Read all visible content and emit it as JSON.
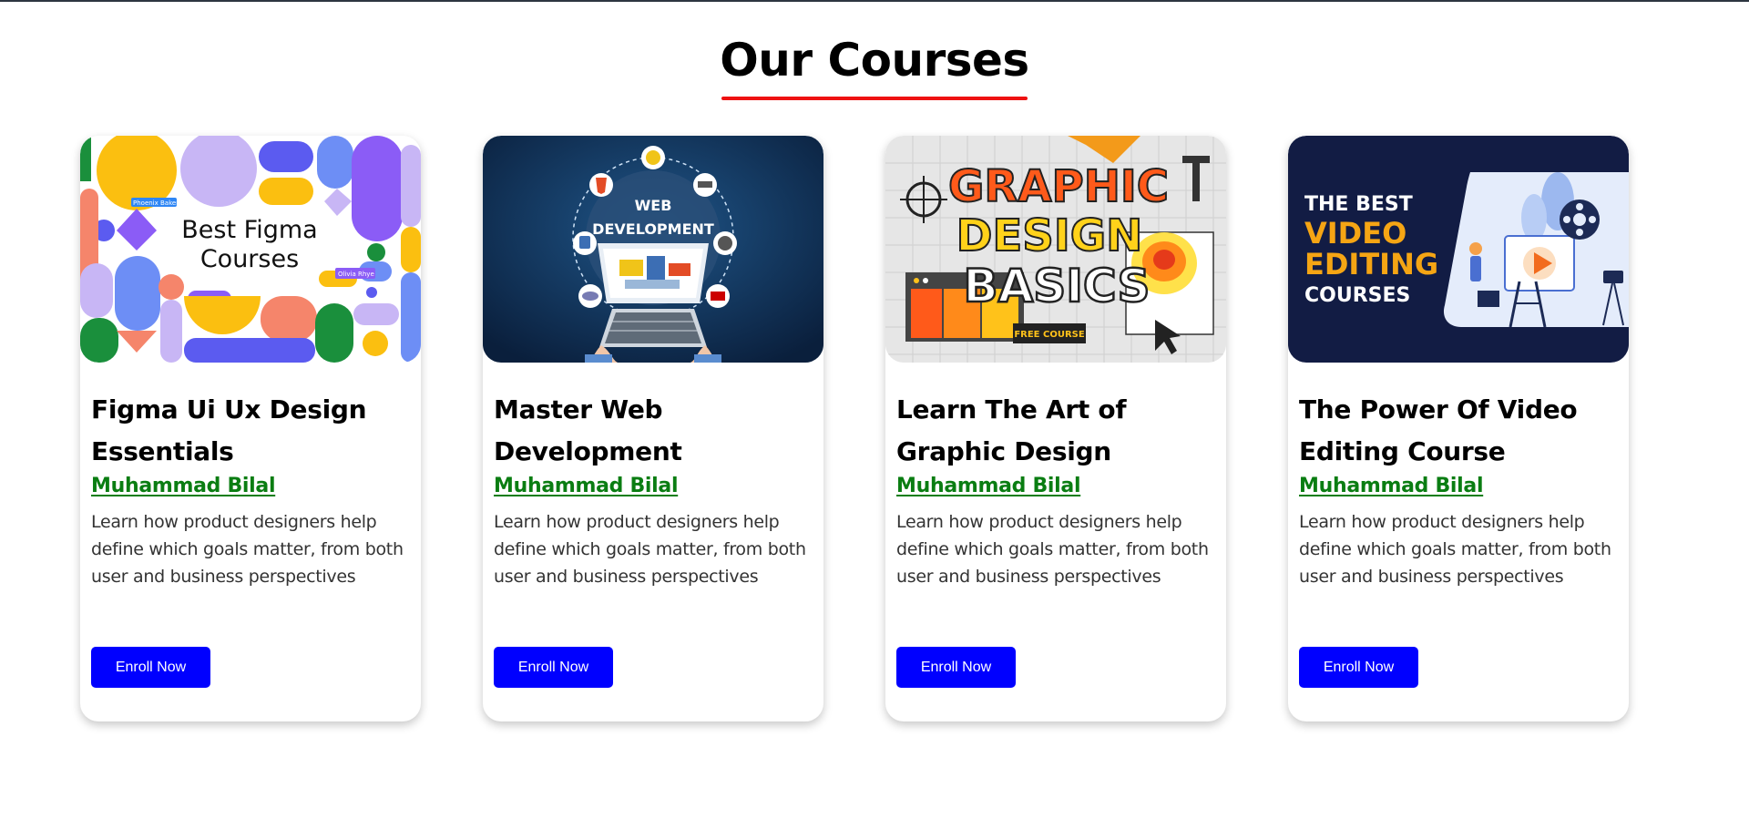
{
  "page": {
    "heading": "Our Courses"
  },
  "courses": [
    {
      "thumb_text": [
        "Best Figma",
        "Courses"
      ],
      "thumb_tags": [
        "Phoenix Baker",
        "Olivia Rhye"
      ],
      "title": "Figma Ui Ux Design Essentials",
      "author": "Muhammad Bilal",
      "description": "Learn how product designers help define which goals matter, from both user and business perspectives",
      "button": "Enroll Now"
    },
    {
      "thumb_text": [
        "WEB",
        "DEVELOPMENT"
      ],
      "title": "Master Web Development",
      "author": "Muhammad Bilal",
      "description": "Learn how product designers help define which goals matter, from both user and business perspectives",
      "button": "Enroll Now"
    },
    {
      "thumb_text": [
        "GRAPHIC",
        "DESIGN",
        "BASICS",
        "FREE COURSE"
      ],
      "title": "Learn The Art of Graphic Design",
      "author": "Muhammad Bilal",
      "description": "Learn how product designers help define which goals matter, from both user and business perspectives",
      "button": "Enroll Now"
    },
    {
      "thumb_text": [
        "THE BEST",
        "VIDEO",
        "EDITING",
        "COURSES"
      ],
      "title": "The Power Of Video Editing Course",
      "author": "Muhammad Bilal",
      "description": "Learn how product designers help define which goals matter, from both user and business perspectives",
      "button": "Enroll Now"
    }
  ],
  "colors": {
    "heading_underline": "#ee1111",
    "author_link": "#0a7d12",
    "button_bg": "#0000ff",
    "button_text": "#ffffff"
  },
  "icons": [
    "play-icon",
    "film-reel-icon",
    "keyboard-icon",
    "cursor-icon",
    "globe-icon"
  ]
}
